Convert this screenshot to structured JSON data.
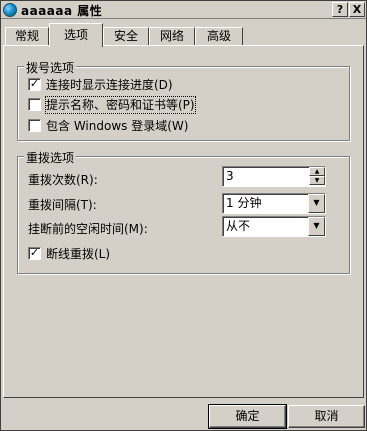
{
  "window": {
    "title": "aaaaaa 属性",
    "help_label": "?",
    "close_label": "X"
  },
  "tabs": [
    {
      "label": "常规",
      "active": false
    },
    {
      "label": "选项",
      "active": true
    },
    {
      "label": "安全",
      "active": false
    },
    {
      "label": "网络",
      "active": false
    },
    {
      "label": "高级",
      "active": false
    }
  ],
  "dial_options": {
    "legend": "拨号选项",
    "items": [
      {
        "label": "连接时显示连接进度(D)",
        "checked": true
      },
      {
        "label": "提示名称、密码和证书等(P)",
        "checked": false
      },
      {
        "label": "包含 Windows 登录域(W)",
        "checked": false
      }
    ]
  },
  "redial_options": {
    "legend": "重拨选项",
    "redial_attempts_label": "重拨次数(R):",
    "redial_attempts_value": "3",
    "redial_interval_label": "重拨间隔(T):",
    "redial_interval_value": "1 分钟",
    "idle_time_label": "挂断前的空闲时间(M):",
    "idle_time_value": "从不",
    "redial_on_disconnect_label": "断线重拨(L)",
    "redial_on_disconnect_checked": true
  },
  "buttons": {
    "ok": "确定",
    "cancel": "取消"
  },
  "glyphs": {
    "check": "✓",
    "spin_up": "▲",
    "spin_down": "▼",
    "dropdown": "▼"
  }
}
